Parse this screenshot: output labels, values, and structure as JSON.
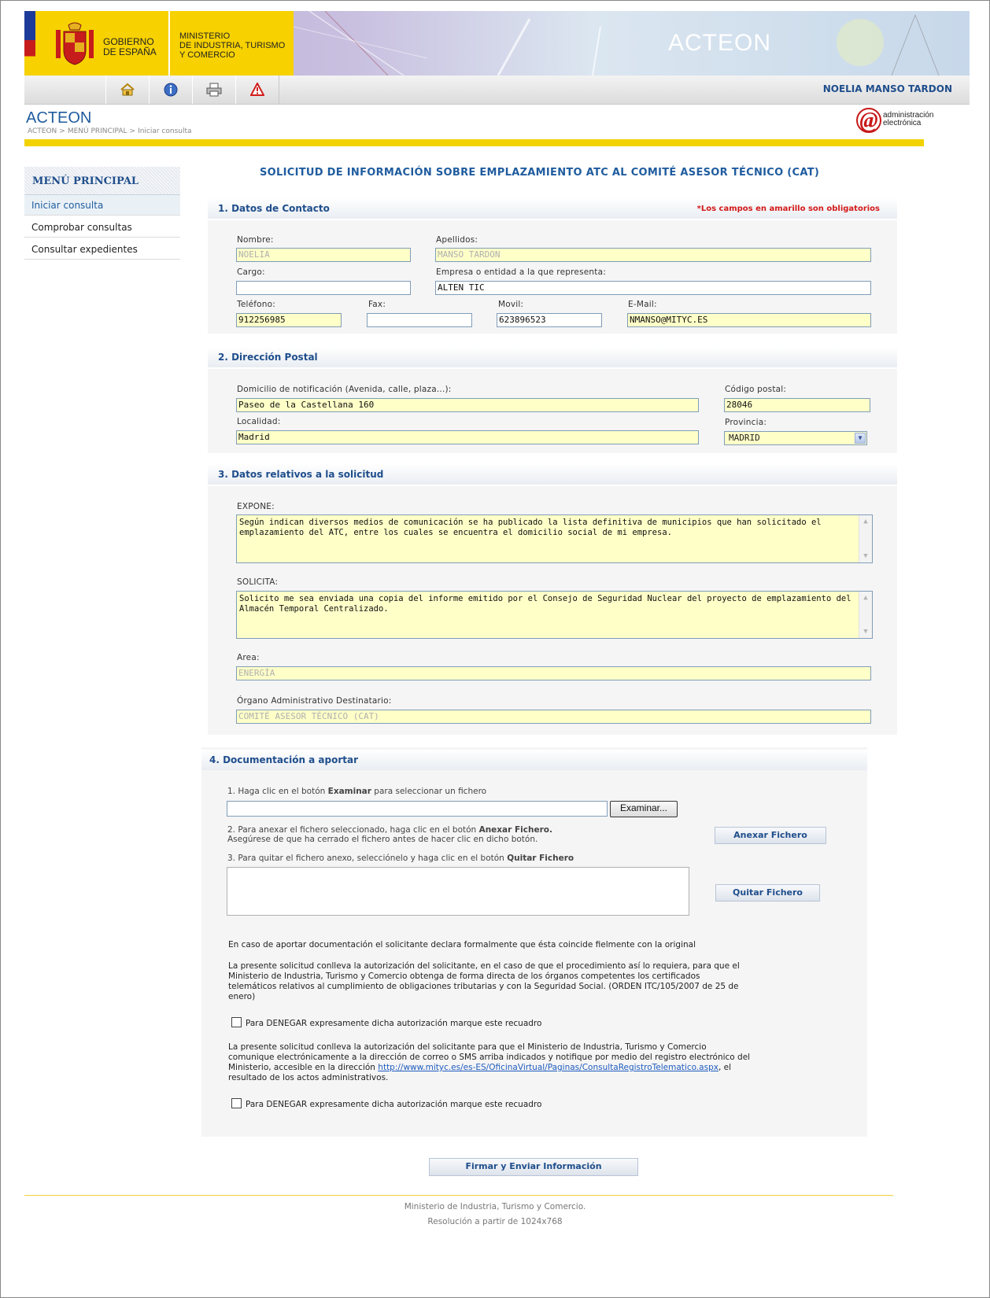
{
  "header": {
    "gov_line1": "GOBIERNO",
    "gov_line2": "DE ESPAÑA",
    "min_line1": "MINISTERIO",
    "min_line2": "DE INDUSTRIA, TURISMO",
    "min_line3": "Y COMERCIO",
    "brand": "ACTEON",
    "user": "NOELIA MANSO TARDON"
  },
  "toolbar": {
    "icons": [
      "home-icon",
      "info-icon",
      "print-icon",
      "warning-icon"
    ]
  },
  "page": {
    "title": "ACTEON",
    "breadcrumb": [
      "ACTEON",
      "MENÚ PRINCIPAL",
      "Iniciar consulta"
    ],
    "ae_line1": "administración",
    "ae_line2": "electrónica"
  },
  "sidebar": {
    "heading": "MENÚ PRINCIPAL",
    "items": [
      {
        "label": "Iniciar consulta"
      },
      {
        "label": "Comprobar consultas"
      },
      {
        "label": "Consultar expedientes"
      }
    ]
  },
  "form": {
    "title": "SOLICITUD DE INFORMACIÓN SOBRE EMPLAZAMIENTO ATC AL COMITÉ ASESOR TÉCNICO (CAT)",
    "required_note": "*Los campos en amarillo son obligatorios",
    "s1": {
      "heading": "1. Datos de Contacto",
      "nombre_label": "Nombre:",
      "nombre": "NOELIA",
      "apellidos_label": "Apellidos:",
      "apellidos": "MANSO TARDON",
      "cargo_label": "Cargo:",
      "cargo": "",
      "empresa_label": "Empresa o entidad a la que representa:",
      "empresa": "ALTEN TIC",
      "telefono_label": "Teléfono:",
      "telefono": "912256985",
      "fax_label": "Fax:",
      "fax": "",
      "movil_label": "Movil:",
      "movil": "623896523",
      "email_label": "E-Mail:",
      "email": "NMANSO@MITYC.ES"
    },
    "s2": {
      "heading": "2. Dirección Postal",
      "domicilio_label": "Domicilio de notificación (Avenida, calle, plaza...):",
      "domicilio": "Paseo de la Castellana 160",
      "cp_label": "Código postal:",
      "cp": "28046",
      "localidad_label": "Localidad:",
      "localidad": "Madrid",
      "provincia_label": "Provincia:",
      "provincia": "MADRID"
    },
    "s3": {
      "heading": "3. Datos relativos a la solicitud",
      "expone_label": "EXPONE:",
      "expone": "Según indican diversos medios de comunicación se ha publicado la lista definitiva de municipios que han solicitado el emplazamiento del ATC, entre los cuales se encuentra el domicilio social de mi empresa.",
      "solicita_label": "SOLICITA:",
      "solicita": "Solicito me sea enviada una copia del informe emitido por el Consejo de Seguridad Nuclear del proyecto de emplazamiento del Almacén Temporal Centralizado.",
      "area_label": "Area:",
      "area": "ENERGÍA",
      "organo_label": "Órgano Administrativo Destinatario:",
      "organo": "COMITÉ ASESOR TÉCNICO (CAT)"
    },
    "s4": {
      "heading": "4. Documentación a aportar",
      "step1_a": "1. Haga clic en el botón ",
      "step1_b": "Examinar",
      "step1_c": " para seleccionar un fichero",
      "browse": "Examinar...",
      "step2_a": "2. Para anexar el fichero seleccionado, haga clic en el botón ",
      "step2_b": "Anexar Fichero.",
      "step2_line2": "Asegúrese de que ha cerrado el fichero antes de hacer clic en dicho botón.",
      "step3_a": "3. Para quitar el fichero anexo, selecciónelo y haga clic en el botón ",
      "step3_b": "Quitar Fichero",
      "attach": "Anexar Fichero",
      "remove": "Quitar Fichero"
    },
    "legal1": "En caso de aportar documentación el solicitante declara formalmente que ésta coincide fielmente con la original",
    "legal2_l1": "La presente solicitud conlleva la autorización del solicitante, en el caso de que el procedimiento así lo requiera, para que el",
    "legal2_l2": "Ministerio de Industria, Turismo y Comercio obtenga de forma directa de los órganos competentes los certificados",
    "legal2_l3": "telemáticos relativos al cumplimiento de obligaciones tributarias y con la Seguridad Social. (ORDEN ITC/105/2007 de 25 de",
    "legal2_l4": "enero)",
    "deny1": "Para DENEGAR expresamente dicha autorización marque este recuadro",
    "legal3_l1": "La presente solicitud conlleva la autorización del solicitante para que el Ministerio de Industria, Turismo y Comercio",
    "legal3_l2": "comunique electrónicamente a la dirección de correo o SMS arriba indicados y notifique por medio del registro electrónico del",
    "legal3_l3a": "Ministerio, accesible en la dirección ",
    "legal3_link": "http://www.mityc.es/es-ES/OficinaVirtual/Paginas/ConsultaRegistroTelematico.aspx",
    "legal3_l3b": ", el",
    "legal3_l4": "resultado de los actos administrativos.",
    "deny2": "Para DENEGAR expresamente dicha autorización marque este recuadro",
    "submit": "Firmar y Enviar Información"
  },
  "footer": {
    "line1": "Ministerio de Industria, Turismo y Comercio.",
    "line2": "Resolución a partir de 1024x768"
  },
  "colors": {
    "accent": "#1f5c9f",
    "required_bg": "#ffffc8",
    "gov_yellow": "#f7d100",
    "required_text": "#d31a1a"
  }
}
